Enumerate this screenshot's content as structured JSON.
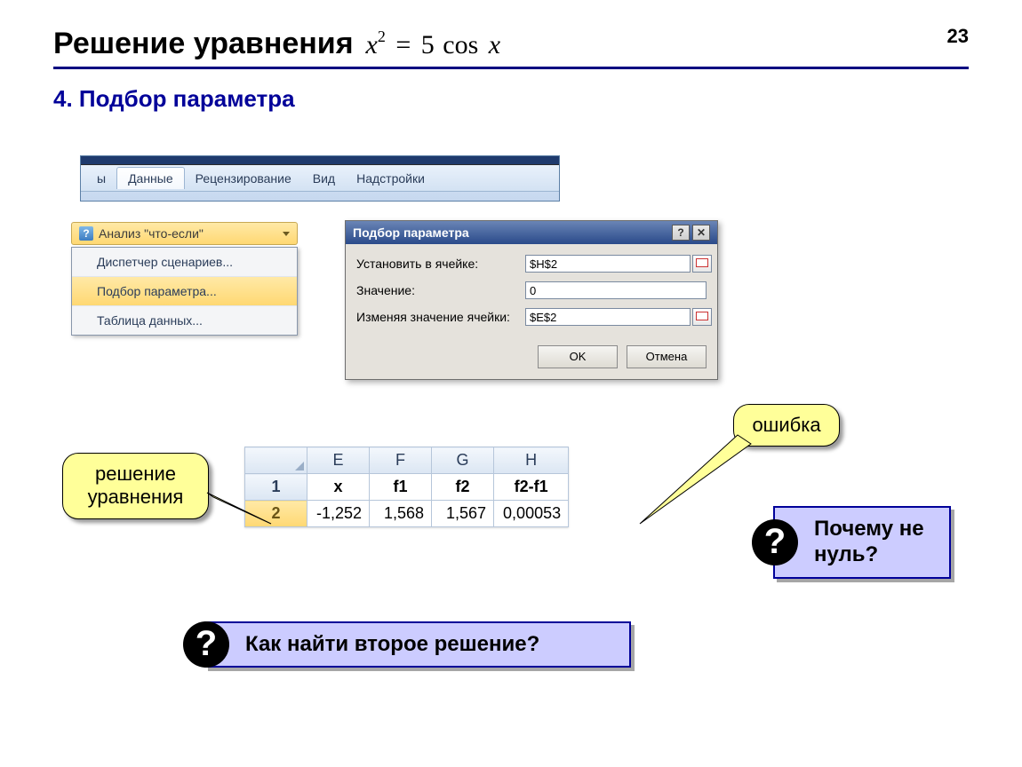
{
  "page_number": "23",
  "title": "Решение уравнения",
  "equation": {
    "lhs_var": "x",
    "lhs_pow": "2",
    "eq": "=",
    "rhs_coef": "5",
    "rhs_fn": "cos",
    "rhs_var": "x"
  },
  "subtitle": "4. Подбор параметра",
  "ribbon": {
    "partial_tab": "ы",
    "tabs": [
      "Данные",
      "Рецензирование",
      "Вид",
      "Надстройки"
    ],
    "active_index": 0
  },
  "whatif": {
    "button": "Анализ \"что-если\"",
    "items": [
      "Диспетчер сценариев...",
      "Подбор параметра...",
      "Таблица данных..."
    ],
    "highlight_index": 1
  },
  "dialog": {
    "title": "Подбор параметра",
    "help_symbol": "?",
    "close_symbol": "✕",
    "rows": [
      {
        "label": "Установить в ячейке:",
        "value": "$H$2",
        "ref": true
      },
      {
        "label": "Значение:",
        "value": "0",
        "ref": false
      },
      {
        "label": "Изменяя значение ячейки:",
        "value": "$E$2",
        "ref": true
      }
    ],
    "ok": "OK",
    "cancel": "Отмена"
  },
  "grid": {
    "cols": [
      "E",
      "F",
      "G",
      "H"
    ],
    "header_row": [
      "x",
      "f1",
      "f2",
      "f2-f1"
    ],
    "data_row": [
      "-1,252",
      "1,568",
      "1,567",
      "0,00053"
    ],
    "row_nums": [
      "1",
      "2"
    ]
  },
  "callouts": {
    "reshenie": "решение уравнения",
    "oshibka": "ошибка"
  },
  "questions": {
    "why": "Почему не нуль?",
    "how": "Как найти второе решение?",
    "mark": "?"
  }
}
